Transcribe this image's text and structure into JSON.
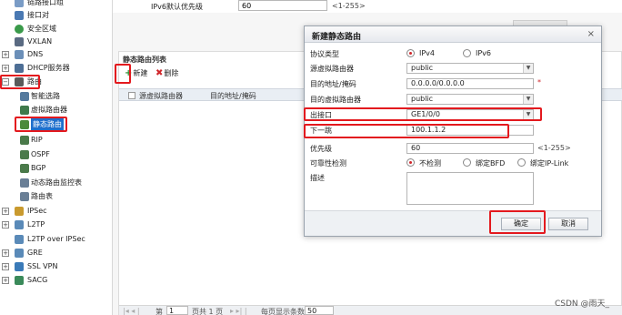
{
  "sidebar": {
    "items": [
      {
        "label": "链路接口组",
        "icon": "link-group-icon"
      },
      {
        "label": "接口对",
        "icon": "interface-pair-icon"
      },
      {
        "label": "安全区域",
        "icon": "security-zone-icon"
      },
      {
        "label": "VXLAN",
        "icon": "vxlan-icon"
      },
      {
        "label": "DNS",
        "icon": "dns-icon"
      },
      {
        "label": "DHCP服务器",
        "icon": "dhcp-server-icon"
      },
      {
        "label": "路由",
        "icon": "route-folder-icon"
      },
      {
        "label": "智能选路",
        "icon": "smart-routing-icon"
      },
      {
        "label": "虚拟路由器",
        "icon": "virtual-router-icon"
      },
      {
        "label": "静态路由",
        "icon": "static-route-icon"
      },
      {
        "label": "RIP",
        "icon": "rip-icon"
      },
      {
        "label": "OSPF",
        "icon": "ospf-icon"
      },
      {
        "label": "BGP",
        "icon": "bgp-icon"
      },
      {
        "label": "动态路由监控表",
        "icon": "monitor-table-icon"
      },
      {
        "label": "路由表",
        "icon": "route-table-icon"
      },
      {
        "label": "IPSec",
        "icon": "ipsec-icon"
      },
      {
        "label": "L2TP",
        "icon": "l2tp-icon"
      },
      {
        "label": "L2TP over IPSec",
        "icon": "l2tp-ipsec-icon"
      },
      {
        "label": "GRE",
        "icon": "gre-icon"
      },
      {
        "label": "SSL VPN",
        "icon": "ssl-vpn-icon"
      },
      {
        "label": "SACG",
        "icon": "sacg-icon"
      }
    ]
  },
  "main": {
    "ipv6_label": "IPv6默认优先级",
    "ipv6_value": "60",
    "ipv6_hint": "<1-255>",
    "panel_title": "静态路由列表",
    "toolbar": {
      "new_label": "新建",
      "delete_label": "删除"
    },
    "table_headers": [
      "源虚拟路由器",
      "目的地址/掩码"
    ],
    "pager": {
      "page_prefix": "第",
      "page_value": "1",
      "page_suffix": "页共 1 页",
      "per_page_label": "每页显示条数",
      "per_page_value": "50"
    }
  },
  "dialog": {
    "title": "新建静态路由",
    "close": "×",
    "protocol": {
      "label": "协议类型",
      "options": [
        "IPv4",
        "IPv6"
      ],
      "selected": "IPv4"
    },
    "src_router": {
      "label": "源虚拟路由器",
      "value": "public"
    },
    "dest": {
      "label": "目的地址/掩码",
      "value": "0.0.0.0/0.0.0.0",
      "required": "*"
    },
    "dest_router": {
      "label": "目的虚拟路由器",
      "value": "public"
    },
    "out_iface": {
      "label": "出接口",
      "value": "GE1/0/0"
    },
    "next_hop": {
      "label": "下一跳",
      "value": "100.1.1.2"
    },
    "priority": {
      "label": "优先级",
      "value": "60",
      "hint": "<1-255>"
    },
    "reachability": {
      "label": "可靠性检测",
      "options": [
        "不检测",
        "绑定BFD",
        "绑定IP-Link"
      ],
      "selected": "不检测"
    },
    "description": {
      "label": "描述",
      "value": ""
    },
    "ok_label": "确定",
    "cancel_label": "取消"
  },
  "watermark": "CSDN @雨天_",
  "colors": {
    "highlight": "#e3191e",
    "selection": "#1f6fcc",
    "radio_on": "#d0262b"
  }
}
